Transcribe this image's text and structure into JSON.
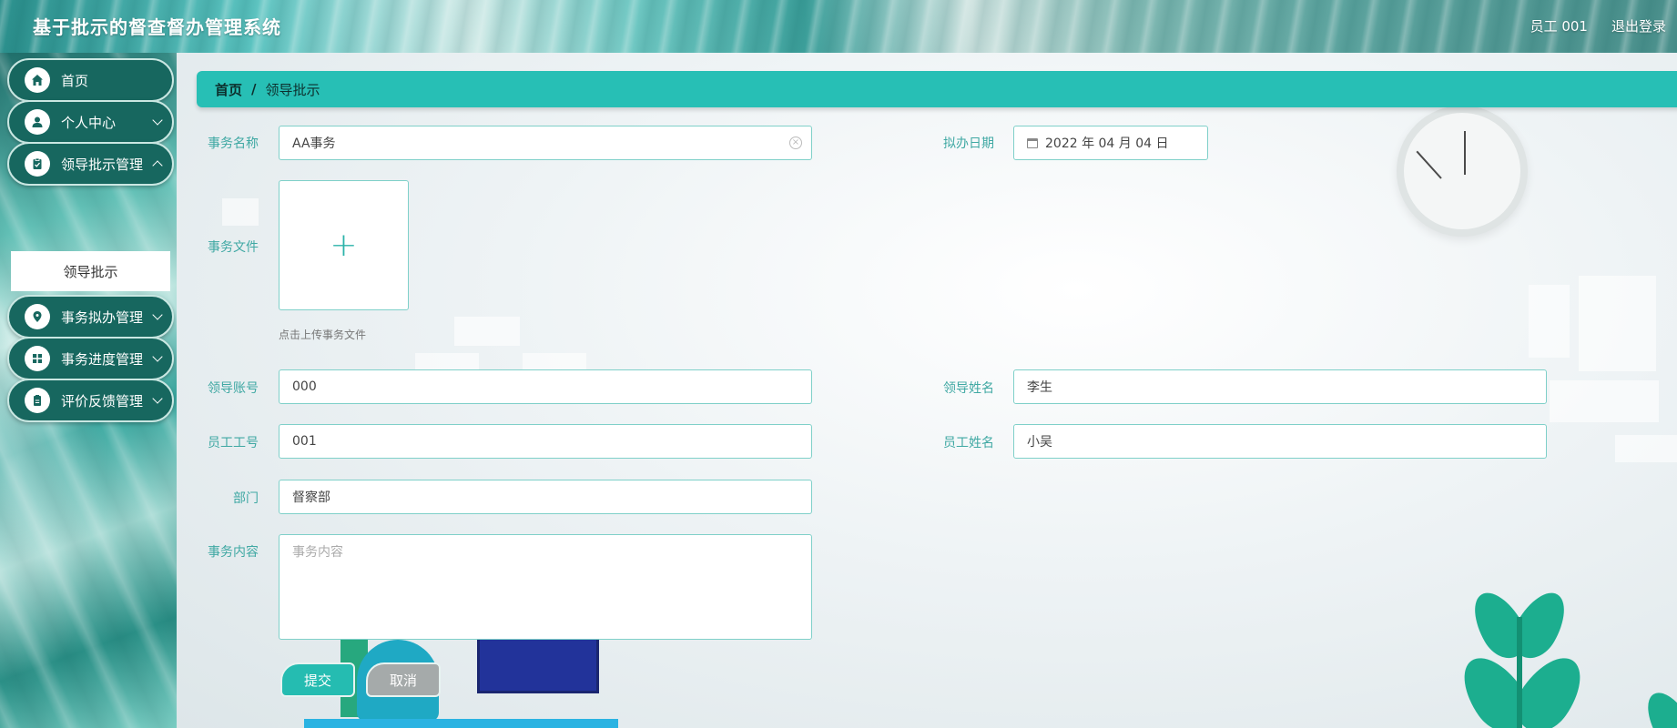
{
  "header": {
    "app_title": "基于批示的督查督办管理系统",
    "user_label": "员工 001",
    "logout_label": "退出登录"
  },
  "sidebar": {
    "items": [
      {
        "label": "首页",
        "icon": "home-icon"
      },
      {
        "label": "个人中心",
        "icon": "user-icon"
      },
      {
        "label": "领导批示管理",
        "icon": "clipboard-icon"
      },
      {
        "label": "事务拟办管理",
        "icon": "location-icon"
      },
      {
        "label": "事务进度管理",
        "icon": "grid-icon"
      },
      {
        "label": "评价反馈管理",
        "icon": "document-icon"
      }
    ],
    "active_sub": "领导批示"
  },
  "breadcrumb": {
    "home": "首页",
    "separator": "/",
    "current": "领导批示"
  },
  "form": {
    "affair_name_label": "事务名称",
    "affair_name_value": "AA事务",
    "draft_date_label": "拟办日期",
    "draft_date_value": "2022 年 04 月 04 日",
    "affair_file_label": "事务文件",
    "upload_hint": "点击上传事务文件",
    "leader_account_label": "领导账号",
    "leader_account_value": "000",
    "leader_name_label": "领导姓名",
    "leader_name_value": "李生",
    "employee_id_label": "员工工号",
    "employee_id_value": "001",
    "employee_name_label": "员工姓名",
    "employee_name_value": "小吴",
    "department_label": "部门",
    "department_value": "督察部",
    "content_label": "事务内容",
    "content_placeholder": "事务内容",
    "submit_label": "提交",
    "cancel_label": "取消"
  },
  "colors": {
    "accent": "#27bfb5",
    "sidebar_item_bg": "#17675f",
    "label_color": "#3fa8a3"
  }
}
